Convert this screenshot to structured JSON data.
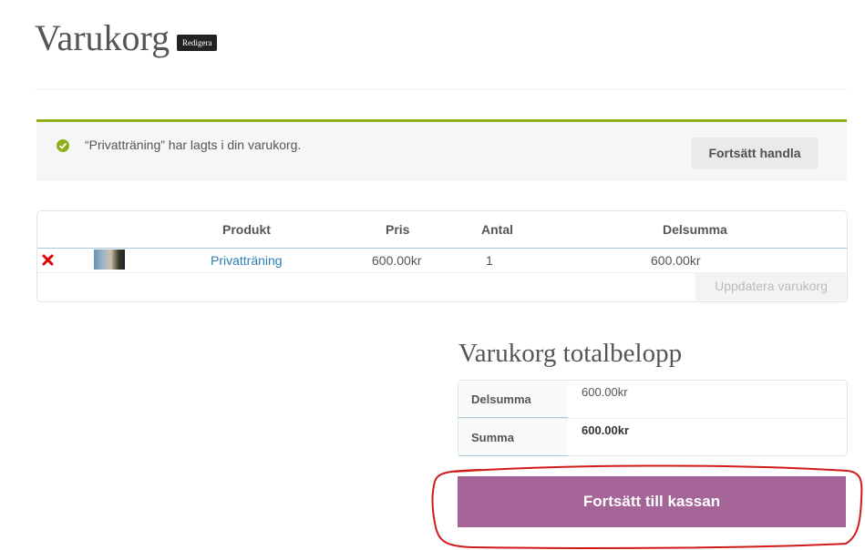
{
  "page": {
    "title": "Varukorg",
    "edit_label": "Redigera"
  },
  "notice": {
    "message": "“Privatträning” har lagts i din varukorg.",
    "continue_label": "Fortsätt handla",
    "icon": "check-circle-icon",
    "accent_color": "#8fae1b"
  },
  "cart": {
    "columns": [
      "",
      "",
      "Produkt",
      "Pris",
      "Antal",
      "Delsumma"
    ],
    "rows": [
      {
        "remove_icon": "remove-x-icon",
        "product": "Privatträning",
        "price": "600.00kr",
        "qty": "1",
        "subtotal": "600.00kr"
      }
    ],
    "update_label": "Uppdatera varukorg"
  },
  "totals": {
    "title": "Varukorg totalbelopp",
    "rows": [
      {
        "label": "Delsumma",
        "value": "600.00kr"
      },
      {
        "label": "Summa",
        "value": "600.00kr"
      }
    ]
  },
  "checkout": {
    "label": "Fortsätt till kassan",
    "color": "#a46497"
  },
  "annotation_color": "#d11a1a"
}
